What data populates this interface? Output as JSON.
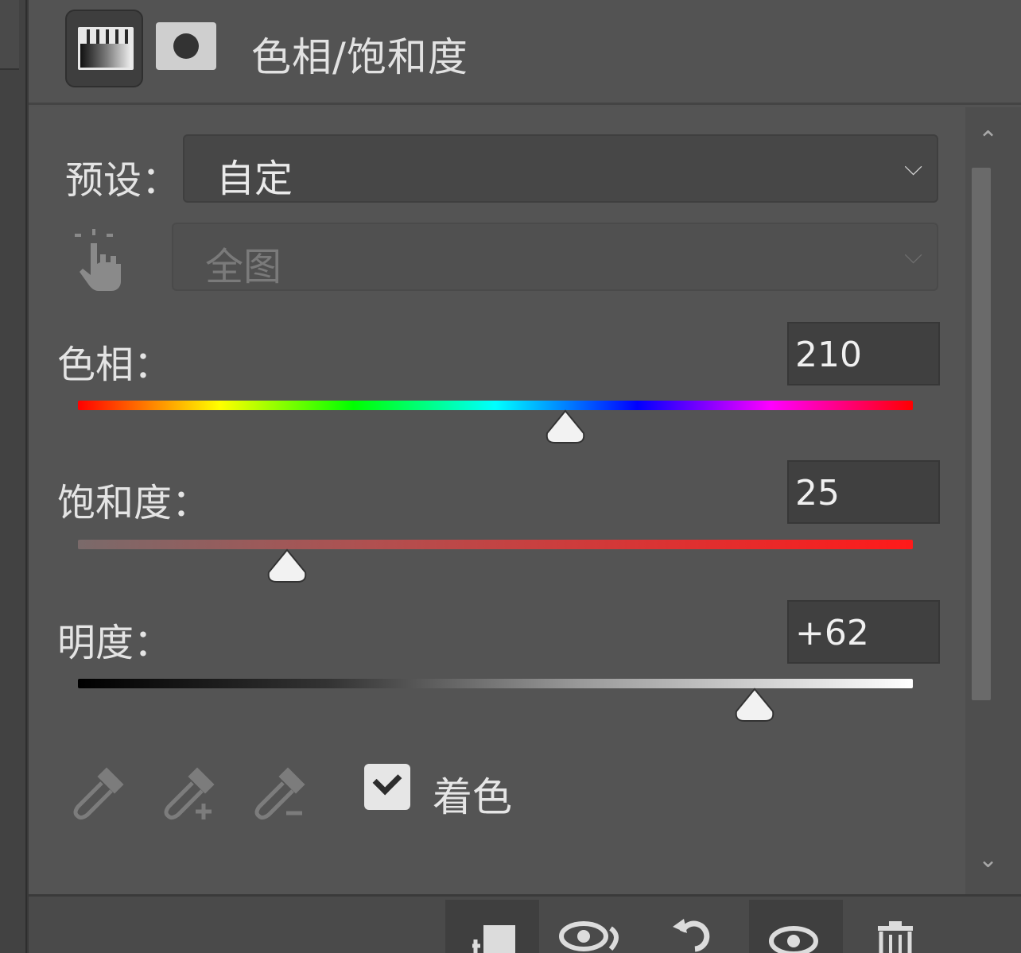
{
  "header": {
    "title": "色相/饱和度"
  },
  "preset": {
    "label": "预设：",
    "value": "自定"
  },
  "range": {
    "value": "全图"
  },
  "hue": {
    "label": "色相：",
    "value": "210",
    "range": [
      -180,
      180
    ]
  },
  "saturation": {
    "label": "饱和度：",
    "value": "25",
    "range": [
      -100,
      100
    ]
  },
  "lightness": {
    "label": "明度：",
    "value": "+62",
    "range": [
      -100,
      100
    ]
  },
  "colorize": {
    "label": "着色",
    "checked": true
  },
  "icons": {
    "header": [
      "adjustment-layer-icon",
      "mask-icon"
    ],
    "tools": [
      "hand-adjust-icon",
      "eyedropper-icon",
      "eyedropper-add-icon",
      "eyedropper-subtract-icon"
    ],
    "footer": [
      "clip-to-layer-icon",
      "view-previous-state-icon",
      "reset-icon",
      "visibility-eye-icon",
      "trash-icon"
    ]
  },
  "colors": {
    "panel_bg": "#535353",
    "input_bg": "#404040",
    "text": "#e4e4e4",
    "saturation_end": "#ff1a1a"
  }
}
